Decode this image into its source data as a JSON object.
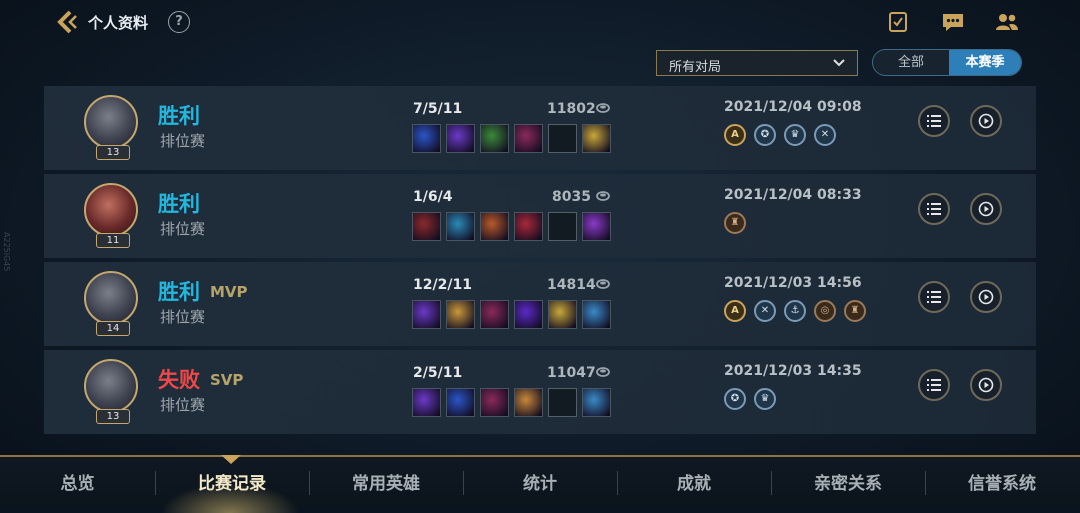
{
  "header": {
    "title": "个人资料",
    "help_label": "?"
  },
  "filters": {
    "match_type": "所有对局",
    "season_options": [
      "全部",
      "本赛季"
    ],
    "selected_season": "本赛季"
  },
  "side_text": "A225IG45",
  "matches": [
    {
      "result": "胜利",
      "result_type": "win",
      "tag": "",
      "mode": "排位赛",
      "level": "13",
      "kda": "7/5/11",
      "gold": "11802",
      "date": "2021/12/04 09:08",
      "items": [
        "#2a55c8",
        "#6a3ac8",
        "#3a8a3a",
        "#8a2a5a",
        "",
        "#c8a83a"
      ],
      "badges": [
        {
          "t": "A",
          "s": "g"
        },
        {
          "t": "✪",
          "s": "b"
        },
        {
          "t": "♛",
          "s": "b"
        },
        {
          "t": "✕",
          "s": "b"
        }
      ]
    },
    {
      "result": "胜利",
      "result_type": "win",
      "tag": "",
      "mode": "排位赛",
      "level": "11",
      "kda": "1/6/4",
      "gold": "8035",
      "date": "2021/12/04 08:33",
      "items": [
        "#8a2a2a",
        "#2a8ab8",
        "#b85a2a",
        "#a8283a",
        "",
        "#8a3ac8"
      ],
      "badges": [
        {
          "t": "♜",
          "s": "c"
        }
      ]
    },
    {
      "result": "胜利",
      "result_type": "win",
      "tag": "MVP",
      "mode": "排位赛",
      "level": "14",
      "kda": "12/2/11",
      "gold": "14814",
      "date": "2021/12/03 14:56",
      "items": [
        "#6a3ac8",
        "#c8983a",
        "#8a2a5a",
        "#5a2ac8",
        "#c8a83a",
        "#3a8ac8"
      ],
      "badges": [
        {
          "t": "A",
          "s": "g"
        },
        {
          "t": "✕",
          "s": "b"
        },
        {
          "t": "⚓",
          "s": "b"
        },
        {
          "t": "◎",
          "s": "c"
        },
        {
          "t": "♜",
          "s": "c"
        }
      ]
    },
    {
      "result": "失败",
      "result_type": "lose",
      "tag": "SVP",
      "mode": "排位赛",
      "level": "13",
      "kda": "2/5/11",
      "gold": "11047",
      "date": "2021/12/03 14:35",
      "items": [
        "#6a3ac8",
        "#2a55c8",
        "#8a2a5a",
        "#c8883a",
        "",
        "#3a8ac8"
      ],
      "badges": [
        {
          "t": "✪",
          "s": "b"
        },
        {
          "t": "♛",
          "s": "b"
        }
      ]
    }
  ],
  "tabs": [
    "总览",
    "比赛记录",
    "常用英雄",
    "统计",
    "成就",
    "亲密关系",
    "信誉系统"
  ],
  "active_tab": "比赛记录"
}
